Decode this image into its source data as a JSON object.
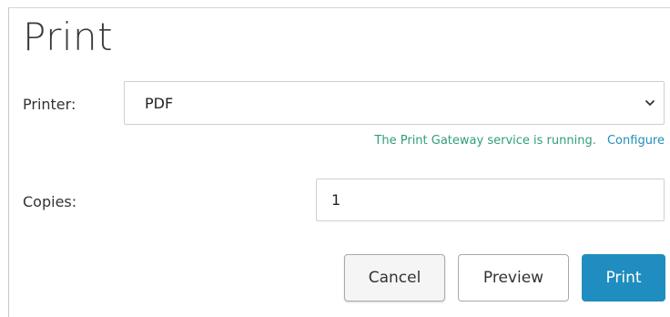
{
  "dialog": {
    "title": "Print"
  },
  "printer": {
    "label": "Printer:",
    "selected": "PDF",
    "status_message": "The Print Gateway service is running.",
    "configure_link": "Configure"
  },
  "copies": {
    "label": "Copies:",
    "value": "1"
  },
  "buttons": {
    "cancel": "Cancel",
    "preview": "Preview",
    "print": "Print"
  },
  "colors": {
    "primary": "#1f8dbf",
    "status_text": "#2f9e7a",
    "link": "#1f8fb8"
  },
  "icons": {
    "dropdown": "chevron-down-icon"
  }
}
